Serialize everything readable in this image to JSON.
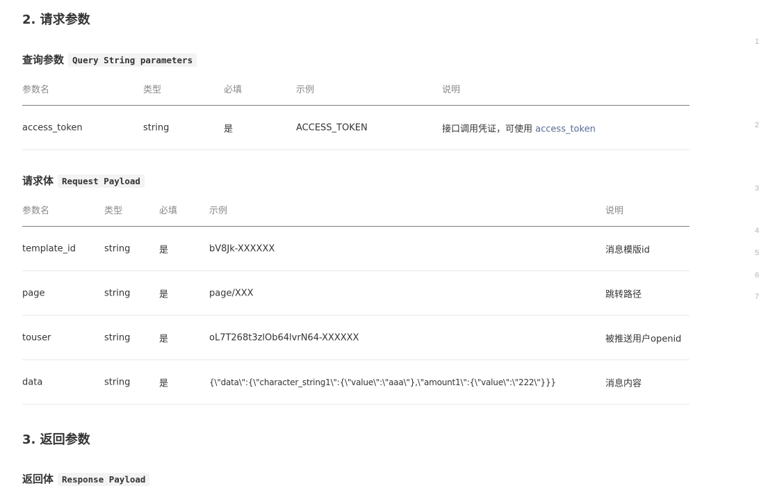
{
  "section2": {
    "title": "2. 请求参数"
  },
  "query": {
    "title": "查询参数",
    "code": "Query String parameters",
    "headers": [
      "参数名",
      "类型",
      "必填",
      "示例",
      "说明"
    ],
    "rows": [
      {
        "name": "access_token",
        "type": "string",
        "required": "是",
        "example": "ACCESS_TOKEN",
        "desc": "接口调用凭证，可使用",
        "desc_link": "access_token"
      }
    ]
  },
  "payload": {
    "title": "请求体",
    "code": "Request Payload",
    "headers": [
      "参数名",
      "类型",
      "必填",
      "示例",
      "说明"
    ],
    "rows": [
      {
        "name": "template_id",
        "type": "string",
        "required": "是",
        "example": "bV8Jk-XXXXXX",
        "desc": "消息模版id"
      },
      {
        "name": "page",
        "type": "string",
        "required": "是",
        "example": "page/XXX",
        "desc": "跳转路径"
      },
      {
        "name": "touser",
        "type": "string",
        "required": "是",
        "example": "oL7T268t3zlOb64lvrN64-XXXXXX",
        "desc": "被推送用户openid"
      },
      {
        "name": "data",
        "type": "string",
        "required": "是",
        "example": "{\\\"data\\\":{\\\"character_string1\\\":{\\\"value\\\":\\\"aaa\\\"},\\\"amount1\\\":{\\\"value\\\":\\\"222\\\"}}}",
        "desc": "消息内容"
      }
    ]
  },
  "section3": {
    "title": "3. 返回参数"
  },
  "response": {
    "title": "返回体",
    "code": "Response Payload"
  },
  "right_numbers": [
    "1",
    "2",
    "3",
    "4",
    "5",
    "6",
    "7"
  ]
}
